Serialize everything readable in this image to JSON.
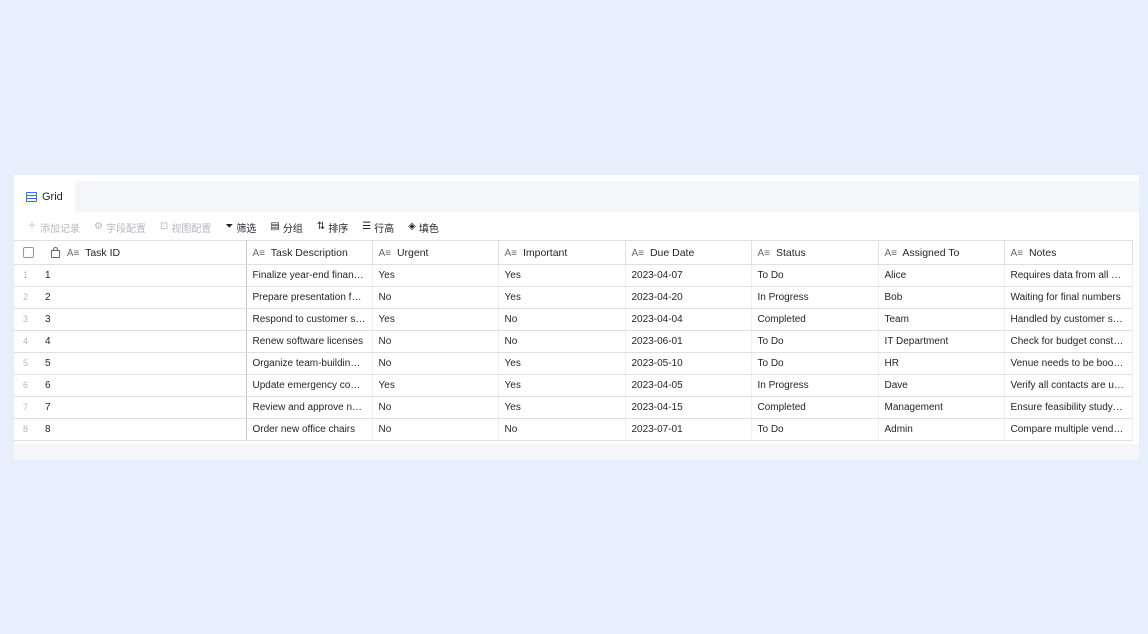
{
  "tab": {
    "label": "Grid"
  },
  "toolbar": {
    "add_record": "添加记录",
    "field_config": "字段配置",
    "view_config": "视图配置",
    "filter": "筛选",
    "group": "分组",
    "sort": "排序",
    "row_height": "行高",
    "fill_color": "填色"
  },
  "columns": [
    {
      "type_icon": "A≡",
      "label": "Task ID"
    },
    {
      "type_icon": "A≡",
      "label": "Task Description"
    },
    {
      "type_icon": "A≡",
      "label": "Urgent"
    },
    {
      "type_icon": "A≡",
      "label": "Important"
    },
    {
      "type_icon": "A≡",
      "label": "Due Date"
    },
    {
      "type_icon": "A≡",
      "label": "Status"
    },
    {
      "type_icon": "A≡",
      "label": "Assigned To"
    },
    {
      "type_icon": "A≡",
      "label": "Notes"
    }
  ],
  "rows": [
    {
      "num": "1",
      "cells": [
        "1",
        "Finalize year-end financial report",
        "Yes",
        "Yes",
        "2023-04-07",
        "To Do",
        "Alice",
        "Requires data from all departments"
      ]
    },
    {
      "num": "2",
      "cells": [
        "2",
        "Prepare presentation for board meeting",
        "No",
        "Yes",
        "2023-04-20",
        "In Progress",
        "Bob",
        "Waiting for final numbers"
      ]
    },
    {
      "num": "3",
      "cells": [
        "3",
        "Respond to customer service inquiries",
        "Yes",
        "No",
        "2023-04-04",
        "Completed",
        "Team",
        "Handled by customer service team"
      ]
    },
    {
      "num": "4",
      "cells": [
        "4",
        "Renew software licenses",
        "No",
        "No",
        "2023-06-01",
        "To Do",
        "IT Department",
        "Check for budget constraints"
      ]
    },
    {
      "num": "5",
      "cells": [
        "5",
        "Organize team-building event",
        "No",
        "Yes",
        "2023-05-10",
        "To Do",
        "HR",
        "Venue needs to be booked"
      ]
    },
    {
      "num": "6",
      "cells": [
        "6",
        "Update emergency contact list",
        "Yes",
        "Yes",
        "2023-04-05",
        "In Progress",
        "Dave",
        "Verify all contacts are up to date"
      ]
    },
    {
      "num": "7",
      "cells": [
        "7",
        "Review and approve new project proposals",
        "No",
        "Yes",
        "2023-04-15",
        "Completed",
        "Management",
        "Ensure feasibility study is complete"
      ]
    },
    {
      "num": "8",
      "cells": [
        "8",
        "Order new office chairs",
        "No",
        "No",
        "2023-07-01",
        "To Do",
        "Admin",
        "Compare multiple vendors"
      ]
    }
  ]
}
